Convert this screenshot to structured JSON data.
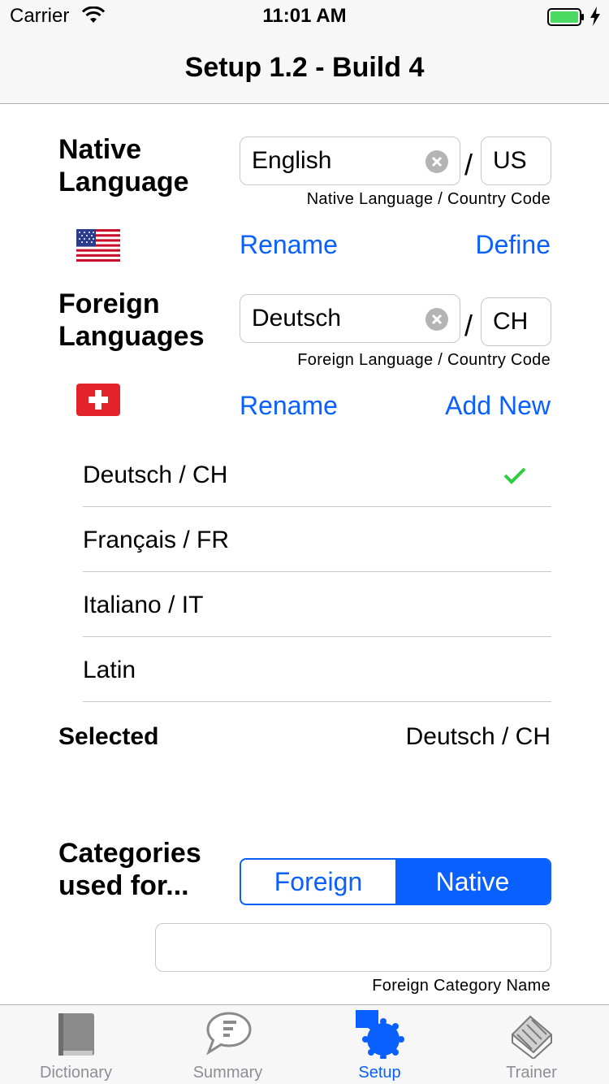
{
  "status_bar": {
    "carrier": "Carrier",
    "time": "11:01 AM"
  },
  "nav": {
    "title": "Setup 1.2 - Build 4"
  },
  "native": {
    "heading_line1": "Native",
    "heading_line2": "Language",
    "language_value": "English",
    "slash": "/",
    "country_value": "US",
    "caption": "Native Language / Country Code",
    "flag": "us-flag-icon",
    "rename_label": "Rename",
    "define_label": "Define"
  },
  "foreign": {
    "heading_line1": "Foreign",
    "heading_line2": "Languages",
    "language_value": "Deutsch",
    "slash": "/",
    "country_value": "CH",
    "caption": "Foreign Language / Country Code",
    "flag": "swiss-flag-icon",
    "rename_label": "Rename",
    "add_new_label": "Add New"
  },
  "languages": [
    {
      "label": "Deutsch / CH",
      "checked": true
    },
    {
      "label": "Français / FR",
      "checked": false
    },
    {
      "label": "Italiano / IT",
      "checked": false
    },
    {
      "label": "Latin",
      "checked": false
    }
  ],
  "selected": {
    "label": "Selected",
    "value": "Deutsch / CH"
  },
  "categories": {
    "heading_line1": "Categories",
    "heading_line2": "used for...",
    "segments": [
      "Foreign",
      "Native"
    ],
    "active_segment": "Native",
    "input_value": "",
    "caption": "Foreign Category Name"
  },
  "tabs": [
    {
      "label": "Dictionary",
      "icon": "book-icon",
      "active": false
    },
    {
      "label": "Summary",
      "icon": "speech-bubble-icon",
      "active": false
    },
    {
      "label": "Setup",
      "icon": "gear-icon",
      "active": true
    },
    {
      "label": "Trainer",
      "icon": "trainer-icon",
      "active": false
    }
  ],
  "colors": {
    "accent": "#0a60ff",
    "check": "#2ecc40",
    "battery": "#4cd964"
  }
}
